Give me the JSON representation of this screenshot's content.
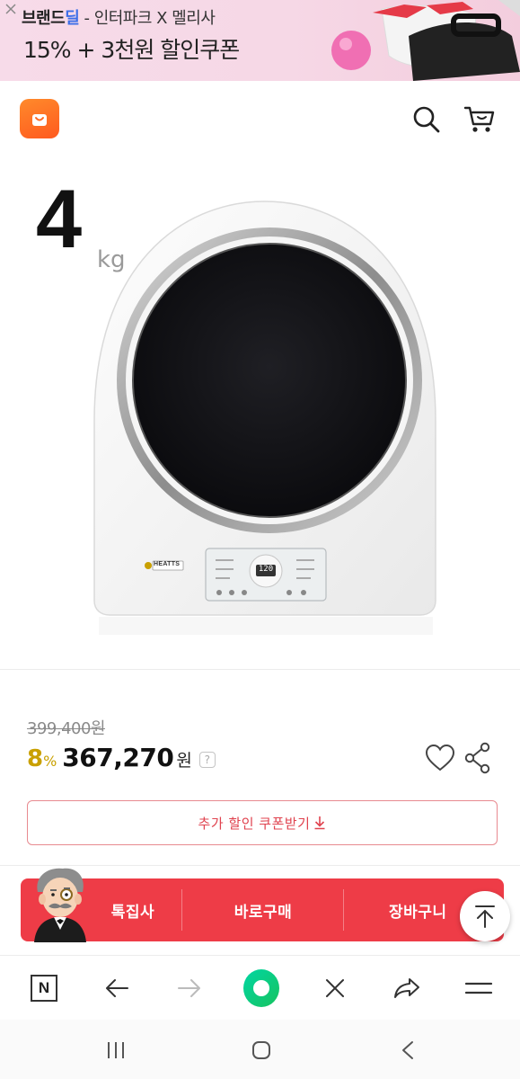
{
  "banner": {
    "brand_a": "브랜드",
    "brand_b": "딜",
    "collab": " - 인터파크 X 멜리사",
    "headline": "15% + 3천원 할인쿠폰",
    "icons": [
      "close-icon",
      "sandal-image",
      "pink-ball-image"
    ]
  },
  "header": {
    "icons": [
      "shopping-bag-logo",
      "search-icon",
      "cart-icon"
    ]
  },
  "product": {
    "weight_value": "4",
    "weight_unit": "kg",
    "brand_label": "HEATTS",
    "display_readout": "120"
  },
  "price": {
    "original": "399,400원",
    "discount": "8",
    "discount_unit": "%",
    "sale": "367,270",
    "currency": "원",
    "help": "?"
  },
  "coupon": {
    "label": "추가 할인 쿠폰받기"
  },
  "actions": {
    "special": "톡집사",
    "buy_now": "바로구매",
    "cart": "장바구니"
  },
  "browser": {
    "n_label": "N",
    "icons": [
      "n-icon",
      "back-arrow-icon",
      "forward-arrow-icon",
      "home-ring-icon",
      "close-icon",
      "share-arrow-icon",
      "menu-icon"
    ]
  },
  "colors": {
    "accent_red": "#ee3c47",
    "discount_gold": "#c9a000",
    "coupon_border": "#e88a90",
    "logo_orange": "#ff6a24",
    "browser_green": "#17c35f"
  }
}
